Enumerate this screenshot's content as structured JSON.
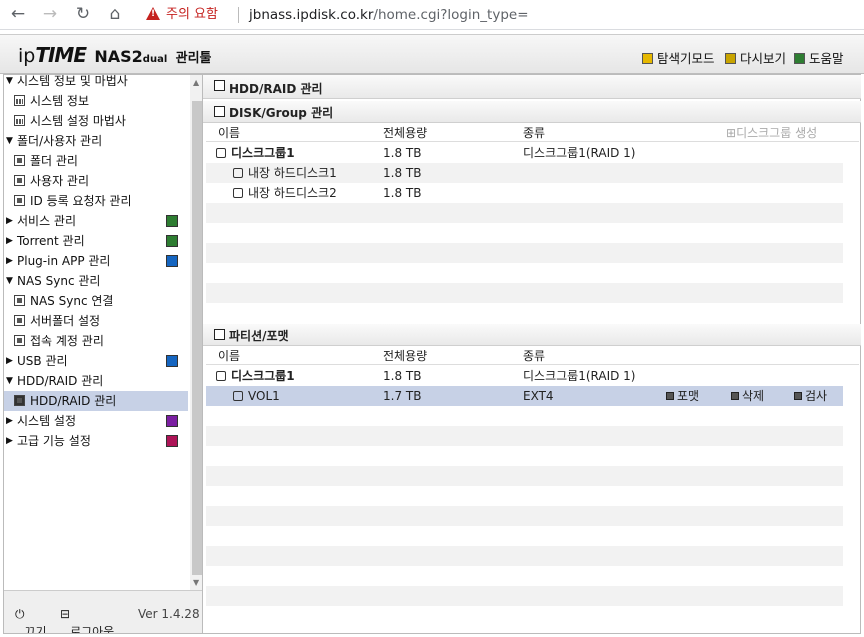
{
  "browser": {
    "warning": "주의 요함",
    "url_host": "jbnass.ipdisk.co.kr",
    "url_path": "/home.cgi?login_type="
  },
  "header": {
    "logo_ip": "ip",
    "logo_time": "TIME",
    "logo_model": "NAS2",
    "logo_dual": "dual",
    "logo_mgr": "관리툴",
    "explorer_mode": "탐색기모드",
    "refresh": "다시보기",
    "help": "도움말"
  },
  "sidebar": {
    "items": [
      {
        "label": "시스템 정보 및 마법사",
        "type": "group-open"
      },
      {
        "label": "시스템 정보",
        "type": "child",
        "icon": "chart-icon"
      },
      {
        "label": "시스템 설정 마법사",
        "type": "child",
        "icon": "chart-icon"
      },
      {
        "label": "폴더/사용자 관리",
        "type": "group-open"
      },
      {
        "label": "폴더 관리",
        "type": "child",
        "icon": "folder-icon"
      },
      {
        "label": "사용자 관리",
        "type": "child",
        "icon": "folder-icon"
      },
      {
        "label": "ID 등록 요청자 관리",
        "type": "child",
        "icon": "folder-icon"
      },
      {
        "label": "서비스 관리",
        "type": "group-closed",
        "right_icon": "#2e7d32"
      },
      {
        "label": "Torrent 관리",
        "type": "group-closed",
        "right_icon": "#2e7d32"
      },
      {
        "label": "Plug-in APP 관리",
        "type": "group-closed",
        "right_icon": "#1565c0"
      },
      {
        "label": "NAS Sync 관리",
        "type": "group-open"
      },
      {
        "label": "NAS Sync 연결",
        "type": "child",
        "icon": "doc-icon"
      },
      {
        "label": "서버폴더 설정",
        "type": "child",
        "icon": "doc-icon"
      },
      {
        "label": "접속 계정 관리",
        "type": "child",
        "icon": "doc-icon"
      },
      {
        "label": "USB 관리",
        "type": "group-closed",
        "right_icon": "#1565c0"
      },
      {
        "label": "HDD/RAID 관리",
        "type": "group-open"
      },
      {
        "label": "HDD/RAID 관리",
        "type": "child-selected",
        "icon": "disk-icon"
      },
      {
        "label": "시스템 설정",
        "type": "group-closed",
        "right_icon": "#7b1fa2"
      },
      {
        "label": "고급 기능 설정",
        "type": "group-closed",
        "right_icon": "#ad1457"
      }
    ],
    "power_off": "끄기",
    "logout": "로그아웃",
    "version": "Ver 1.4.28"
  },
  "main": {
    "title": "HDD/RAID 관리",
    "disk_section": {
      "title": "DISK/Group 관리",
      "columns": [
        "이름",
        "전체용량",
        "종류"
      ],
      "create_action": "디스크그룹 생성",
      "rows": [
        {
          "name": "디스크그룹1",
          "size": "1.8 TB",
          "kind": "디스크그룹1(RAID 1)",
          "level": 0
        },
        {
          "name": "내장 하드디스크1",
          "size": "1.8 TB",
          "kind": "",
          "level": 1
        },
        {
          "name": "내장 하드디스크2",
          "size": "1.8 TB",
          "kind": "",
          "level": 1
        }
      ]
    },
    "partition_section": {
      "title": "파티션/포맷",
      "columns": [
        "이름",
        "전체용량",
        "종류"
      ],
      "rows": [
        {
          "name": "디스크그룹1",
          "size": "1.8 TB",
          "kind": "디스크그룹1(RAID 1)",
          "level": 0
        },
        {
          "name": "VOL1",
          "size": "1.7 TB",
          "kind": "EXT4",
          "level": 1
        }
      ],
      "actions": [
        "포맷",
        "삭제",
        "검사"
      ]
    }
  }
}
